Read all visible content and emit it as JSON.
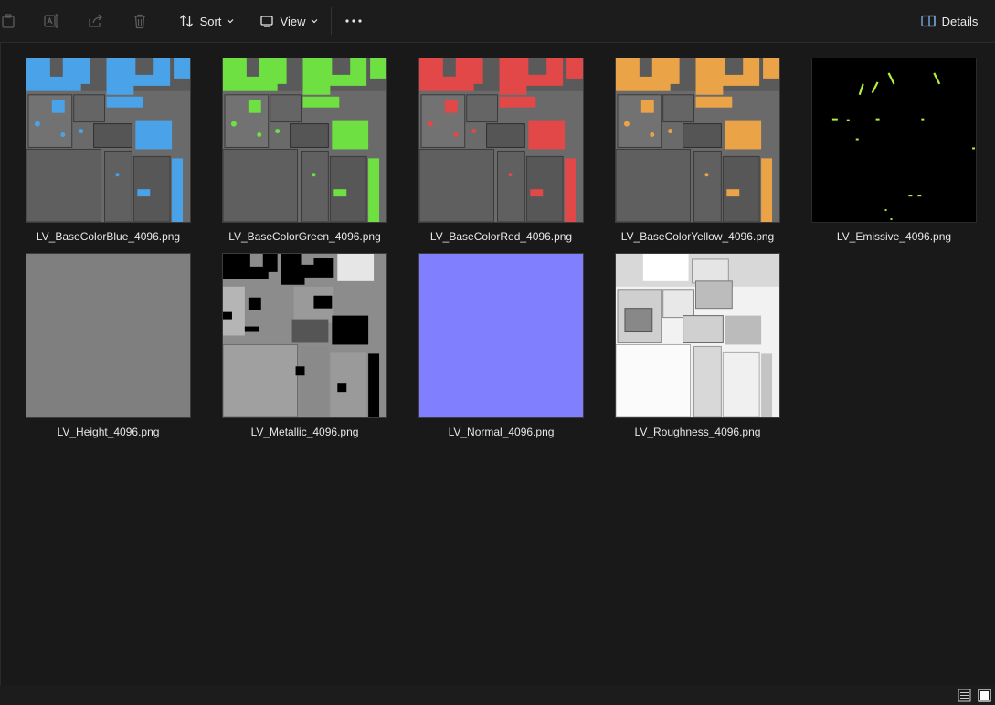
{
  "toolbar": {
    "sort_label": "Sort",
    "view_label": "View",
    "details_label": "Details",
    "icons": [
      "clipboard-icon",
      "rename-icon",
      "share-icon",
      "delete-icon",
      "sort-icon",
      "view-icon",
      "more-icon",
      "details-pane-icon"
    ]
  },
  "files": [
    {
      "name": "LV_BaseColorBlue_4096.png",
      "accent": "#4aa3e8"
    },
    {
      "name": "LV_BaseColorGreen_4096.png",
      "accent": "#6fe042"
    },
    {
      "name": "LV_BaseColorRed_4096.png",
      "accent": "#e24848"
    },
    {
      "name": "LV_BaseColorYellow_4096.png",
      "accent": "#eba347"
    },
    {
      "name": "LV_Emissive_4096.png",
      "accent": "#b6ef3c"
    },
    {
      "name": "LV_Height_4096.png",
      "accent": "#7f7f7f"
    },
    {
      "name": "LV_Metallic_4096.png",
      "accent": "#000000"
    },
    {
      "name": "LV_Normal_4096.png",
      "accent": "#8080ff"
    },
    {
      "name": "LV_Roughness_4096.png",
      "accent": "#ffffff"
    }
  ],
  "statusbar": {
    "icons": [
      "list-view-icon",
      "large-icons-view-icon"
    ]
  }
}
